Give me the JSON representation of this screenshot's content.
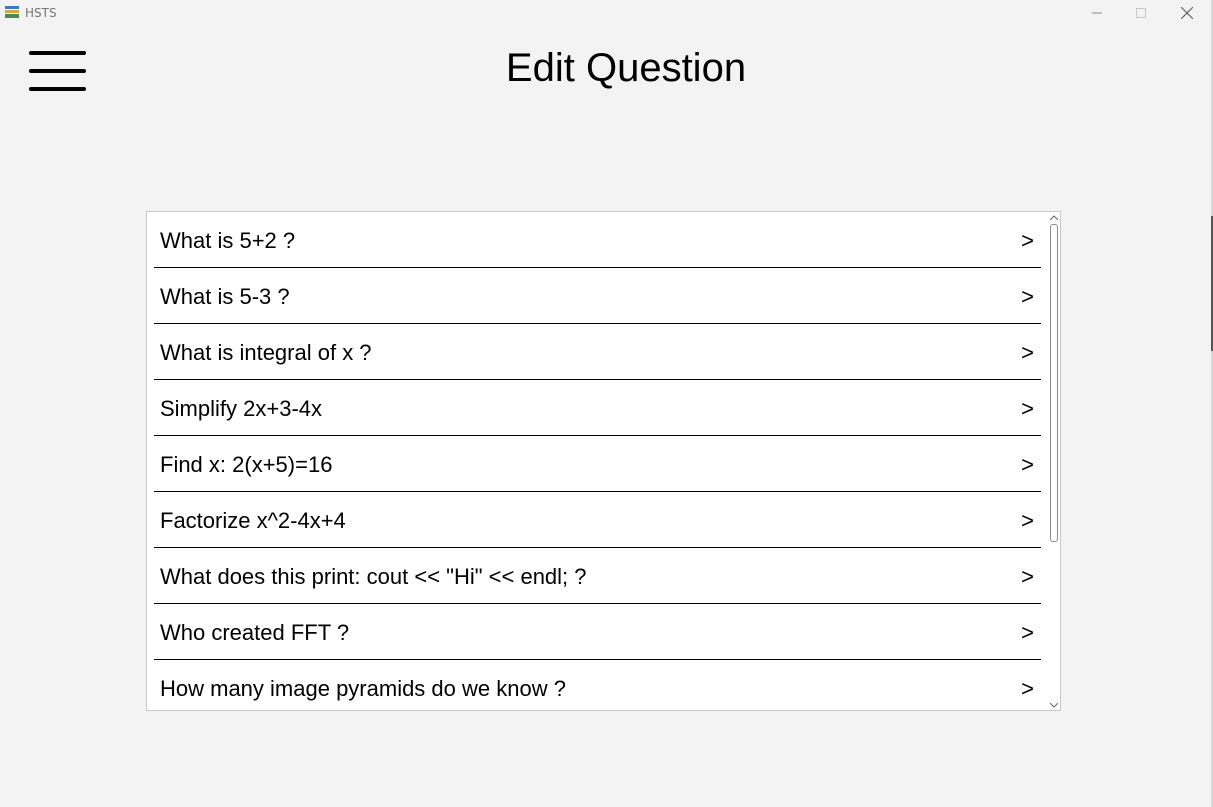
{
  "window": {
    "title": "HSTS"
  },
  "header": {
    "title": "Edit Question"
  },
  "questions": [
    {
      "text": "What is 5+2 ?",
      "arrow": ">"
    },
    {
      "text": "What is 5-3 ?",
      "arrow": ">"
    },
    {
      "text": "What is integral of x ?",
      "arrow": ">"
    },
    {
      "text": "Simplify 2x+3-4x",
      "arrow": ">"
    },
    {
      "text": "Find x: 2(x+5)=16",
      "arrow": ">"
    },
    {
      "text": "Factorize x^2-4x+4",
      "arrow": ">"
    },
    {
      "text": "What does this print: cout << \"Hi\" << endl; ?",
      "arrow": ">"
    },
    {
      "text": "Who created FFT ?",
      "arrow": ">"
    },
    {
      "text": "How many image pyramids do we know ?",
      "arrow": ">"
    }
  ],
  "icons": {
    "app": "app-icon",
    "menu": "hamburger-menu-icon",
    "minimize": "minimize-icon",
    "maximize": "maximize-icon",
    "close": "close-icon"
  }
}
